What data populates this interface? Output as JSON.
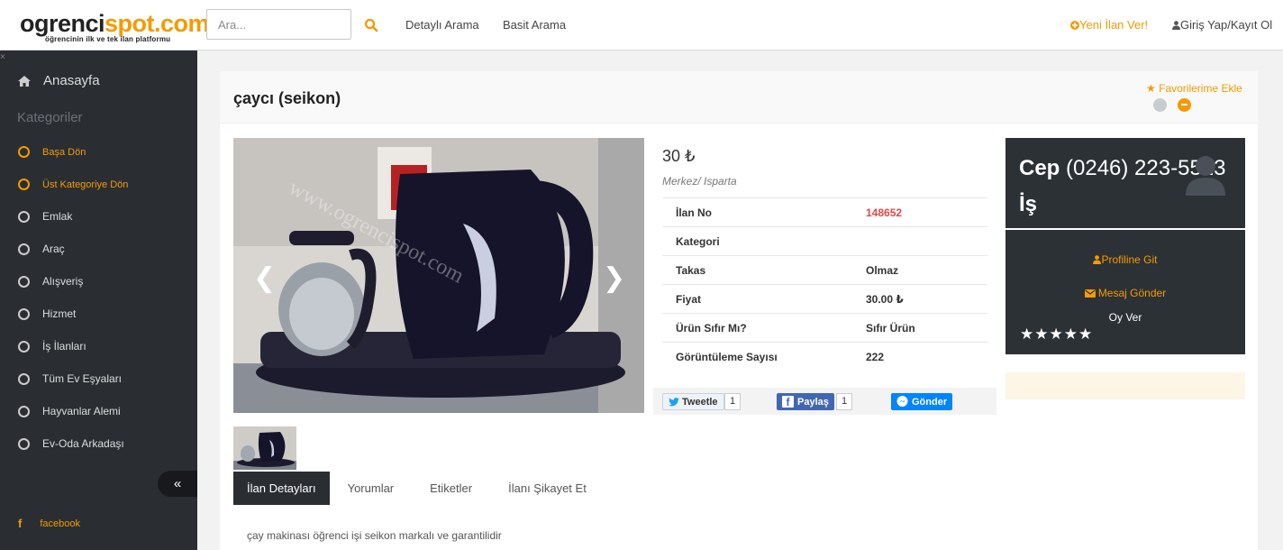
{
  "header": {
    "logo_text_a": "ogrenci",
    "logo_text_b": "spot.com",
    "logo_tagline": "öğrencinin ilk ve tek ilan platformu",
    "search_placeholder": "Ara...",
    "nav_detailed": "Detaylı Arama",
    "nav_basic": "Basit Arama",
    "new_ad": "Yeni İlan Ver!",
    "login": "Giriş Yap/Kayıt Ol"
  },
  "sidebar": {
    "close": "×",
    "home": "Anasayfa",
    "categories_heading": "Kategoriler",
    "items": [
      {
        "label": "Başa Dön"
      },
      {
        "label": "Üst Kategoriye Dön"
      },
      {
        "label": "Emlak"
      },
      {
        "label": "Araç"
      },
      {
        "label": "Alışveriş"
      },
      {
        "label": "Hizmet"
      },
      {
        "label": "İş İlanları"
      },
      {
        "label": "Tüm Ev Eşyaları"
      },
      {
        "label": "Hayvanlar Alemi"
      },
      {
        "label": "Ev-Oda Arkadaşı"
      }
    ],
    "collapse": "«",
    "facebook": "facebook"
  },
  "listing": {
    "title": "çaycı (seikon)",
    "favorite": "Favorilerime Ekle",
    "price": "30 ₺",
    "location": "Merkez/ Isparta",
    "watermark": "www.ogrencispot.com",
    "details": [
      {
        "key": "İlan No",
        "value": "148652"
      },
      {
        "key": "Kategori",
        "value": ""
      },
      {
        "key": "Takas",
        "value": "Olmaz"
      },
      {
        "key": "Fiyat",
        "value": "30.00 ₺"
      },
      {
        "key": "Ürün Sıfır Mı?",
        "value": "Sıfır Ürün"
      },
      {
        "key": "Görüntüleme Sayısı",
        "value": "222"
      }
    ],
    "description": "çay makinası öğrenci işi seikon markalı ve garantilidir"
  },
  "share": {
    "tweet": "Tweetle",
    "tweet_count": "1",
    "fb_share": "Paylaş",
    "fb_count": "1",
    "messenger": "Gönder"
  },
  "contact": {
    "cep_label": "Cep",
    "phone": "(0246) 223-5513",
    "is_label": "İş",
    "profile": "Profiline Git",
    "message": "Mesaj Gönder",
    "vote": "Oy Ver",
    "stars": "★★★★★",
    "rating": 0
  },
  "tabs": [
    {
      "label": "İlan Detayları"
    },
    {
      "label": "Yorumlar"
    },
    {
      "label": "Etiketler"
    },
    {
      "label": "İlanı Şikayet Et"
    }
  ],
  "colors": {
    "accent": "#f59a00",
    "sidebar": "#2a2e33",
    "red": "#e04848"
  }
}
